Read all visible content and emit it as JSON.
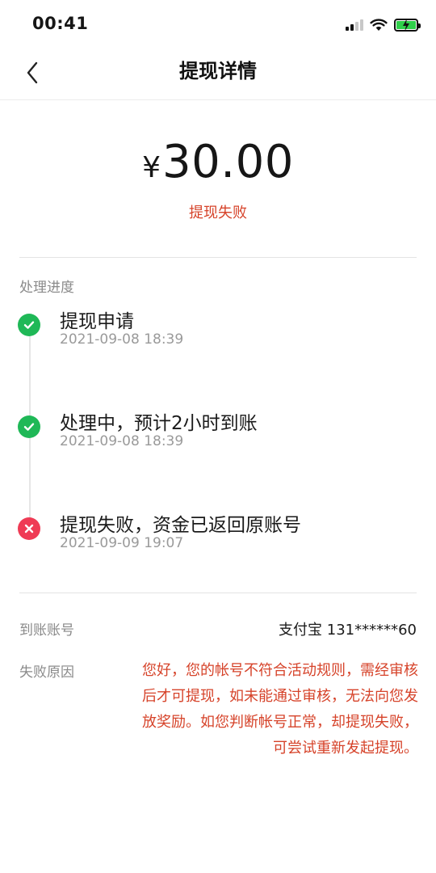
{
  "status_bar": {
    "time": "00:41"
  },
  "nav": {
    "title": "提现详情"
  },
  "withdrawal": {
    "currency": "¥",
    "amount": "30.00",
    "status": "提现失败"
  },
  "progress": {
    "label": "处理进度",
    "steps": [
      {
        "title": "提现申请",
        "time": "2021-09-08 18:39",
        "state": "success"
      },
      {
        "title": "处理中，预计2小时到账",
        "time": "2021-09-08 18:39",
        "state": "success"
      },
      {
        "title": "提现失败，资金已返回原账号",
        "time": "2021-09-09 19:07",
        "state": "failed"
      }
    ]
  },
  "account": {
    "label": "到账账号",
    "value": "支付宝 131******60"
  },
  "failure": {
    "label": "失败原因",
    "reason": "您好，您的帐号不符合活动规则，需经审核后才可提现，如未能通过审核，无法向您发放奖励。如您判断帐号正常，却提现失败，可尝试重新发起提现。"
  },
  "colors": {
    "accent_red": "#d6432a",
    "success_green": "#1fb857",
    "fail_red": "#ef3b55"
  }
}
